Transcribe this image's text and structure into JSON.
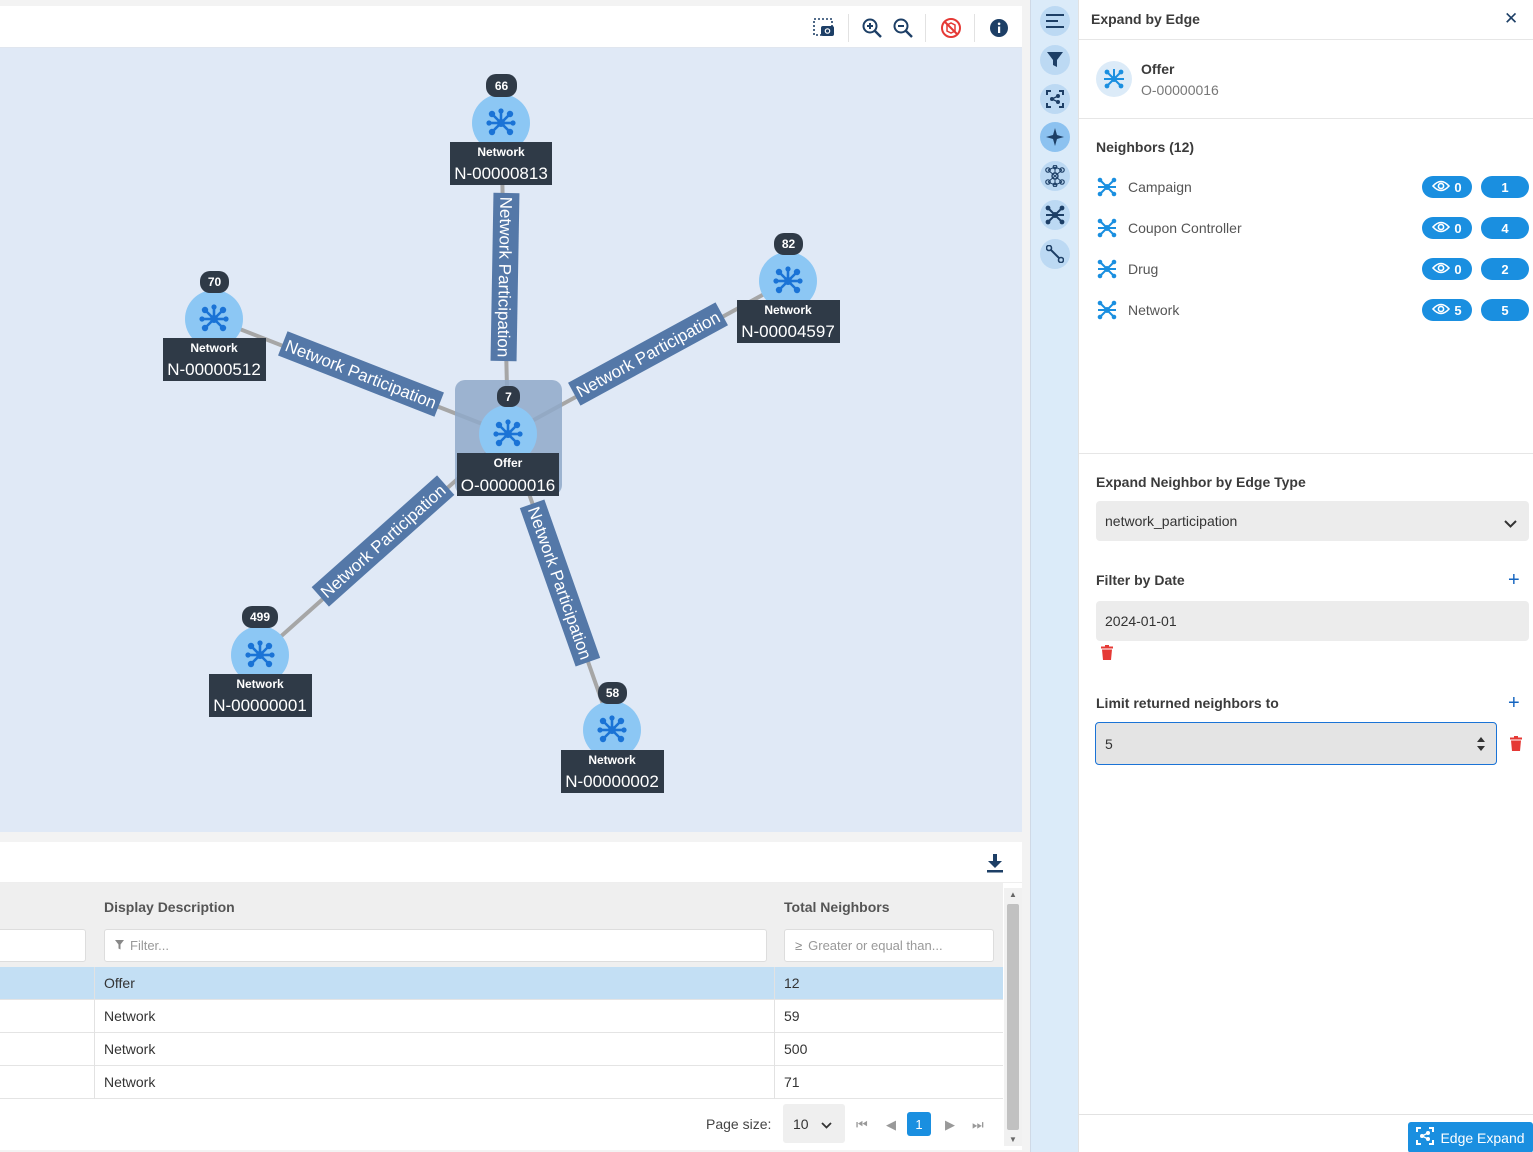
{
  "graph": {
    "center_node": {
      "type": "Offer",
      "id": "O-00000016",
      "count": "7"
    },
    "nodes": [
      {
        "type": "Network",
        "id": "N-00000813",
        "count": "66"
      },
      {
        "type": "Network",
        "id": "N-00004597",
        "count": "82"
      },
      {
        "type": "Network",
        "id": "N-00000512",
        "count": "70"
      },
      {
        "type": "Network",
        "id": "N-00000001",
        "count": "499"
      },
      {
        "type": "Network",
        "id": "N-00000002",
        "count": "58"
      }
    ],
    "edge_label": "Network Participation"
  },
  "table": {
    "columns": {
      "description": "Display Description",
      "neighbors": "Total Neighbors"
    },
    "filters": {
      "description_placeholder": "Filter...",
      "neighbors_placeholder": "Greater or equal than..."
    },
    "rows": [
      {
        "description": "Offer",
        "neighbors": "12"
      },
      {
        "description": "Network",
        "neighbors": "59"
      },
      {
        "description": "Network",
        "neighbors": "500"
      },
      {
        "description": "Network",
        "neighbors": "71"
      }
    ],
    "page_size_label": "Page size:",
    "page_size": "10",
    "current_page": "1"
  },
  "panel": {
    "title": "Expand by Edge",
    "entity": {
      "type": "Offer",
      "id": "O-00000016"
    },
    "neighbors_title": "Neighbors (12)",
    "neighbors": [
      {
        "label": "Campaign",
        "visible": "0",
        "total": "1"
      },
      {
        "label": "Coupon Controller",
        "visible": "0",
        "total": "4"
      },
      {
        "label": "Drug",
        "visible": "0",
        "total": "2"
      },
      {
        "label": "Network",
        "visible": "5",
        "total": "5"
      }
    ],
    "edge_type_label": "Expand Neighbor by Edge Type",
    "edge_type_value": "network_participation",
    "date_label": "Filter by Date",
    "date_value": "2024-01-01",
    "limit_label": "Limit returned neighbors to",
    "limit_value": "5",
    "expand_button": "Edge Expand"
  },
  "colors": {
    "accent": "#1a8fe0",
    "node_fill": "#8cc7f4",
    "node_label_bg": "#2f3a47",
    "edge_label_bg": "#5478a8",
    "canvas_bg": "#e0e9f6"
  }
}
